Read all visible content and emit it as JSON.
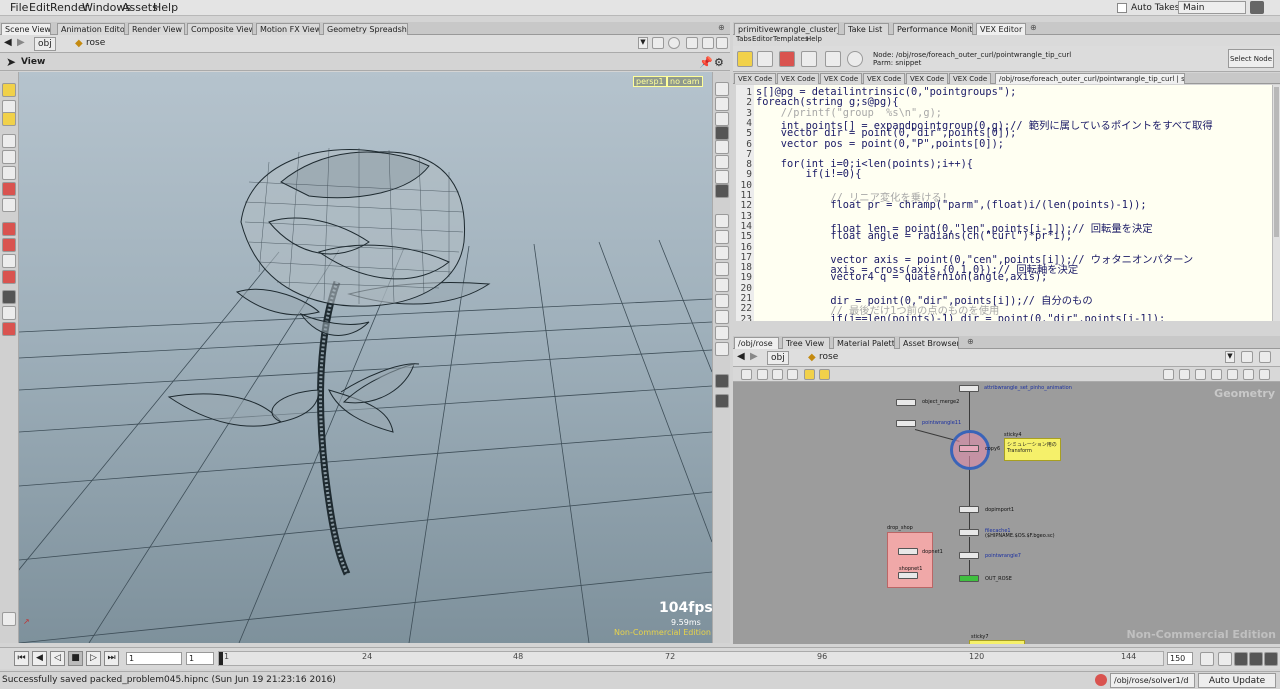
{
  "menu": {
    "items": [
      "File",
      "Edit",
      "Render",
      "Windows",
      "Assets",
      "Help"
    ],
    "auto_takes_label": "Auto Takes",
    "desktop": "Main"
  },
  "left_pane": {
    "tabs": [
      "Scene View",
      "Animation Editor",
      "Render View",
      "Composite View",
      "Motion FX View",
      "Geometry Spreadsheet"
    ],
    "path": {
      "network": "obj",
      "node": "rose"
    },
    "view_label": "View",
    "camera_badges": [
      "persp1",
      "no cam"
    ],
    "fps": "104fps",
    "frame_time": "9.59ms",
    "watermark": "Non-Commercial Edition"
  },
  "right_top_pane": {
    "tabs": [
      "primitivewrangle_cluster_copy",
      "Take List",
      "Performance Monitor",
      "VEX Editor"
    ],
    "menus": [
      "Tabs",
      "Editor",
      "Templates",
      "Help"
    ],
    "node_path": "Node: /obj/rose/foreach_outer_curl/pointwrangle_tip_curl",
    "parm": "Parm: snippet",
    "select_node": "Select Node",
    "code_tabs": [
      "VEX Code",
      "VEX Code",
      "VEX Code",
      "VEX Code",
      "VEX Code",
      "VEX Code",
      "/obj/rose/foreach_outer_curl/pointwrangle_tip_curl | snippet"
    ],
    "code_lines": [
      "s[]@pg = detailintrinsic(0,\"pointgroups\");",
      "foreach(string g;s@pg){",
      "    //printf(\"group  %s\\n\",g);",
      "    int points[] = expandpointgroup(0,g);// 範列に属しているポイントをすべて取得",
      "    vector dir = point(0,\"dir\",points[0]);",
      "    vector pos = point(0,\"P\",points[0]);",
      "",
      "    for(int i=0;i<len(points);i++){",
      "        if(i!=0){",
      "",
      "            // リニア変化を乗ける!",
      "            float pr = chramp(\"parm\",(float)i/(len(points)-1));",
      "",
      "            float len = point(0,\"len\",points[i-1]);// 回転量を決定",
      "            float angle = radians(ch(\"curl\")*pr*i);",
      "",
      "            vector axis = point(0,\"cen\",points[i]);// ウォタニオンパターン",
      "            axis = cross(axis,{0,1,0});// 回転軸を決定",
      "            vector4 q = quaternion(angle,axis);",
      "",
      "            dir = point(0,\"dir\",points[i]);// 自分のもの",
      "            // 最後だけ1つ前の点のものを使用",
      "            if(i==len(points)-1) dir = point(0,\"dir\",points[i-1]);"
    ]
  },
  "right_bottom_pane": {
    "tabs": [
      "/obj/rose",
      "Tree View",
      "Material Palette",
      "Asset Browser"
    ],
    "path": {
      "network": "obj",
      "node": "rose"
    },
    "context_label": "Geometry",
    "watermark": "Non-Commercial Edition",
    "nodes": {
      "attribwrangle": "attribwrangle_set_pinho_animation",
      "object_merge": "object_merge2",
      "pointwrangle": "pointwrangle11",
      "copy": "copy6",
      "sticky_title": "sticky4",
      "sticky_text": "シミュレーション用の\nTransform",
      "dopimport": "dopimport1",
      "filecache": "filecache1",
      "filecache_sub": "($HIPNAME.$OS.$F.bgeo.sc)",
      "pointwrangle7": "pointwrangle7",
      "out": "OUT_ROSE",
      "drop_title": "drop_shop",
      "dopnet": "dopnet1",
      "shopnet": "shopnet1",
      "sticky7": "sticky7"
    }
  },
  "timeline": {
    "start_frame": "1",
    "current_frame": "1",
    "end_frame": "150",
    "ticks": [
      "1",
      "24",
      "48",
      "72",
      "96",
      "120",
      "144"
    ]
  },
  "status": {
    "message": "Successfully saved packed_problem045.hipnc (Sun Jun 19 21:23:16 2016)",
    "path": "/obj/rose/solver1/d",
    "auto_update": "Auto Update"
  },
  "colors": {
    "viewport_top": "#b5c3cd",
    "viewport_bottom": "#7e919c",
    "code_bg": "#fffff2",
    "network_bg": "#9c9c9c",
    "sticky_yellow": "#f5f06a",
    "netbox_pink": "#f0a8a8",
    "output_green": "#3fbf3f"
  }
}
